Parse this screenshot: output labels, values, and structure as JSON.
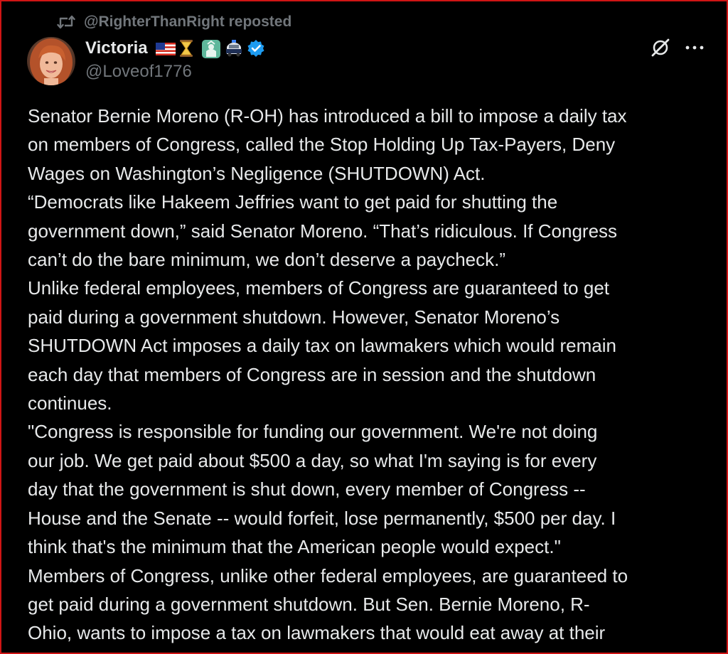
{
  "repost": {
    "label": "@RighterThanRight reposted",
    "icon": "repost-icon"
  },
  "author": {
    "display_name": "Victoria",
    "handle": "@Loveof1776",
    "badges": [
      "us-flag-emoji",
      "hourglass-emoji",
      "statue-of-liberty-emoji",
      "police-car-emoji"
    ],
    "verified_icon": "verified-badge-icon",
    "verified_color": "#1d9bf0"
  },
  "actions": {
    "grok_icon": "grok-icon",
    "more_icon": "more-icon"
  },
  "tweet": {
    "lines": [
      "Senator Bernie Moreno (R-OH) has introduced a bill to impose a daily tax",
      "on members of Congress, called the Stop Holding Up Tax-Payers, Deny",
      "Wages on Washington’s Negligence (SHUTDOWN) Act.",
      "“Democrats like Hakeem Jeffries want to get paid for shutting the",
      "government down,” said Senator Moreno. “That’s ridiculous. If Congress",
      "can’t do the bare minimum, we don’t deserve a paycheck.”",
      "Unlike federal employees, members of Congress are guaranteed to get",
      "paid during a government shutdown. However, Senator Moreno’s",
      "SHUTDOWN Act imposes a daily tax on lawmakers which would remain",
      "each day that members of Congress are in session and the shutdown",
      "continues.",
      "\"Congress is responsible for funding our government. We're not doing",
      "our job. We get paid about $500 a day, so what I'm saying is for every",
      "day that the government is shut down, every member of Congress --",
      "House and the Senate -- would forfeit, lose permanently, $500 per day. I",
      "think that's the minimum that the American people would expect.\"",
      "Members of Congress, unlike other federal employees, are guaranteed to",
      "get paid during a government shutdown. But Sen. Bernie Moreno, R-",
      "Ohio, wants to impose a tax on lawmakers that would eat away at their"
    ]
  },
  "colors": {
    "background": "#000000",
    "text": "#e7e9ea",
    "secondary_text": "#71767b",
    "frame_border": "#d01515"
  }
}
